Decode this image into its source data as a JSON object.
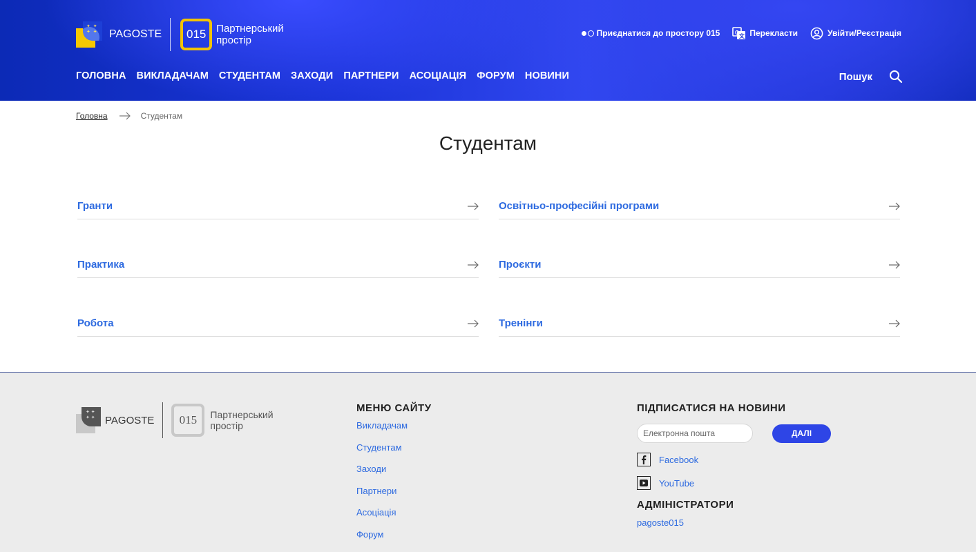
{
  "header": {
    "brand": "PAGOSTE",
    "number": "015",
    "partner_line1": "Партнерський",
    "partner_line2": "простір",
    "join_label": "Приєднатися до простору 015",
    "translate_label": "Перекласти",
    "login_label": "Увійти/Реєстрація",
    "nav": [
      "ГОЛОВНА",
      "ВИКЛАДАЧАМ",
      "СТУДЕНТАМ",
      "ЗАХОДИ",
      "ПАРТНЕРИ",
      "АСОЦІАЦІЯ",
      "ФОРУМ",
      "НОВИНИ"
    ],
    "search_label": "Пошук"
  },
  "breadcrumb": {
    "home": "Головна",
    "current": "Студентам"
  },
  "page_title": "Студентам",
  "links": [
    {
      "label": "Гранти"
    },
    {
      "label": "Освітньо-професійні програми"
    },
    {
      "label": "Практика"
    },
    {
      "label": "Проєкти"
    },
    {
      "label": "Робота"
    },
    {
      "label": "Тренінги"
    }
  ],
  "footer": {
    "brand": "PAGOSTE",
    "number": "015",
    "partner_line1": "Партнерський",
    "partner_line2": "простір",
    "menu_heading": "МЕНЮ САЙТУ",
    "menu": [
      "Викладачам",
      "Студентам",
      "Заходи",
      "Партнери",
      "Асоціація",
      "Форум"
    ],
    "subscribe_heading": "ПІДПИСАТИСЯ НА НОВИНИ",
    "email_placeholder": "Електронна пошта",
    "submit_label": "ДАЛІ",
    "facebook": "Facebook",
    "youtube": "YouTube",
    "admins_heading": "АДМІНІСТРАТОРИ",
    "admin_name": "pagoste015"
  },
  "colors": {
    "header_blue": "#1b34d8",
    "accent_yellow": "#f4c400",
    "link_blue": "#2d6ae0",
    "button_blue": "#2e45e6"
  }
}
